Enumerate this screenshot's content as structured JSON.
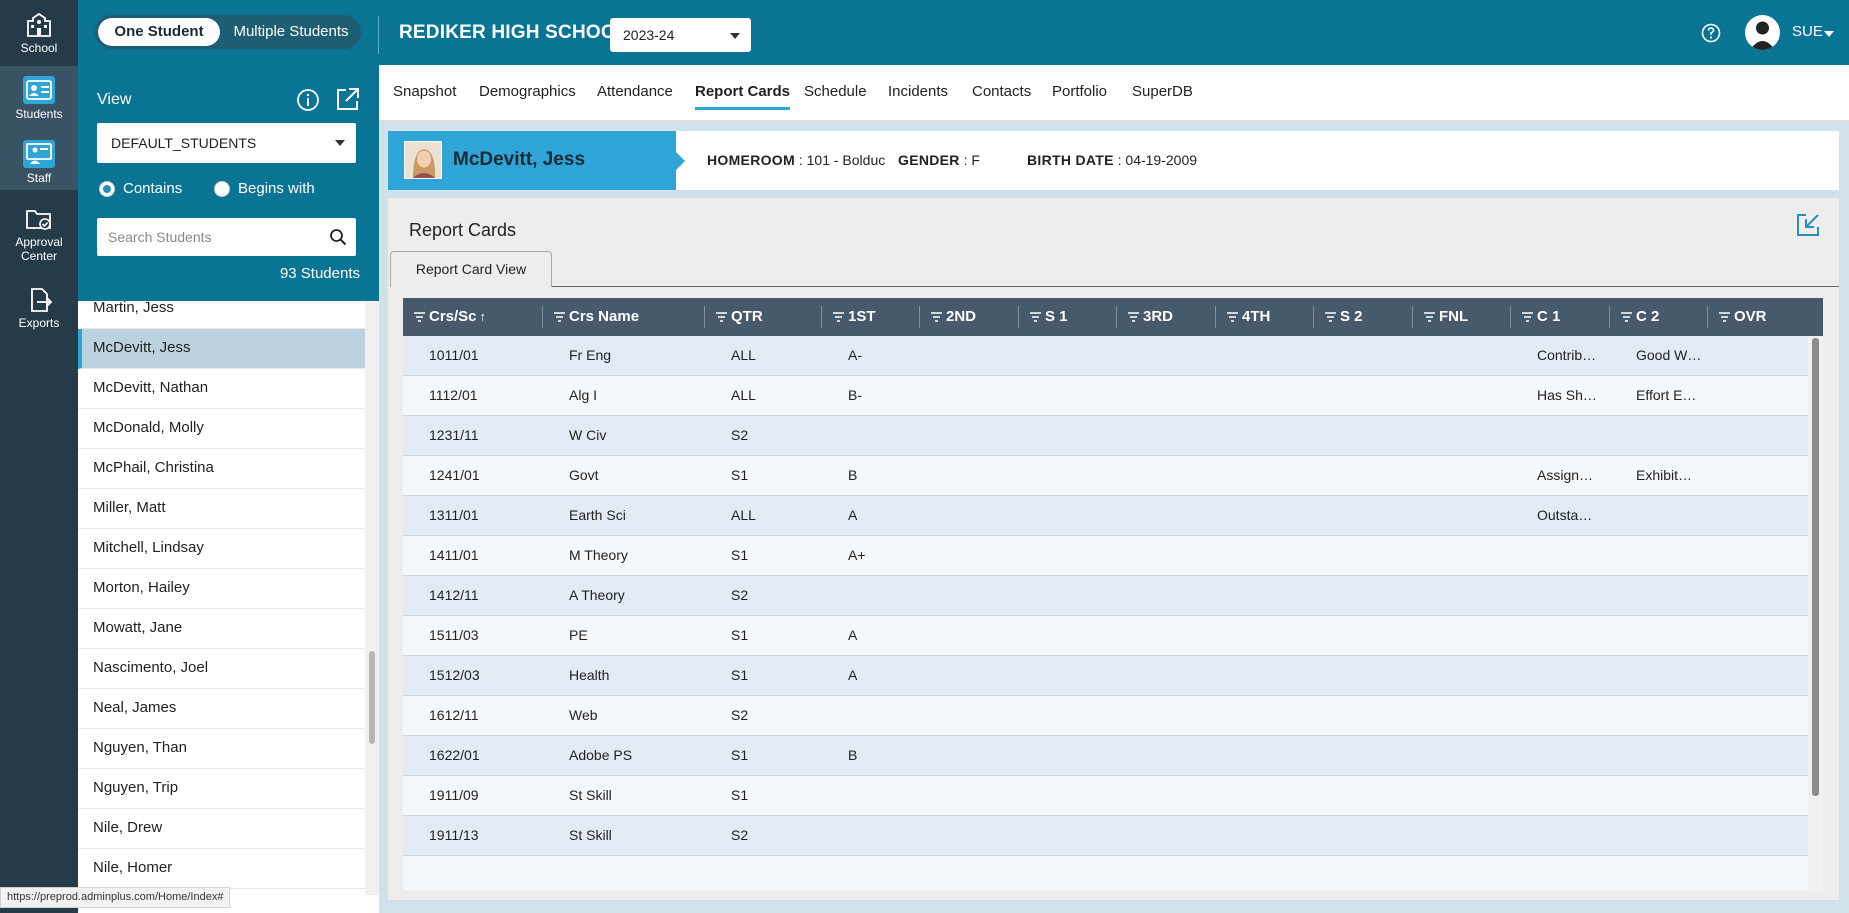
{
  "rail": {
    "items": [
      {
        "label": "School",
        "icon": "school-icon"
      },
      {
        "label": "Students",
        "icon": "students-icon"
      },
      {
        "label": "Staff",
        "icon": "staff-icon"
      },
      {
        "label": "Approval Center",
        "icon": "folder-check-icon"
      },
      {
        "label": "Exports",
        "icon": "export-file-icon"
      }
    ]
  },
  "topbar": {
    "toggle": {
      "one": "One Student",
      "multiple": "Multiple Students"
    },
    "school_name": "REDIKER HIGH SCHOOL",
    "year": "2023-24",
    "user": "SUE"
  },
  "panel": {
    "view_label": "View",
    "view_value": "DEFAULT_STUDENTS",
    "radio_contains": "Contains",
    "radio_begins": "Begins with",
    "search_placeholder": "Search Students",
    "count": "93 Students",
    "students": [
      "Martin, Jess",
      "McDevitt, Jess",
      "McDevitt, Nathan",
      "McDonald, Molly",
      "McPhail, Christina",
      "Miller, Matt",
      "Mitchell, Lindsay",
      "Morton, Hailey",
      "Mowatt, Jane",
      "Nascimento, Joel",
      "Neal, James",
      "Nguyen, Than",
      "Nguyen, Trip",
      "Nile, Drew",
      "Nile, Homer"
    ],
    "selected_index": 1
  },
  "status_url": "https://preprod.adminplus.com/Home/Index#",
  "tabs": [
    "Snapshot",
    "Demographics",
    "Attendance",
    "Report Cards",
    "Schedule",
    "Incidents",
    "Contacts",
    "Portfolio",
    "SuperDB"
  ],
  "active_tab": "Report Cards",
  "student": {
    "name": "McDevitt, Jess",
    "homeroom_label": "HOMEROOM",
    "homeroom_value": ": 101 - Bolduc",
    "gender_label": "GENDER",
    "gender_value": ": F",
    "birth_label": "BIRTH DATE",
    "birth_value": ": 04-19-2009"
  },
  "card": {
    "title": "Report Cards",
    "subtab": "Report Card View"
  },
  "grid": {
    "columns": [
      "Crs/Sc",
      "Crs Name",
      "QTR",
      "1ST",
      "2ND",
      "S 1",
      "3RD",
      "4TH",
      "S 2",
      "FNL",
      "C 1",
      "C 2",
      "OVR"
    ],
    "sort_indicator": "↑",
    "rows": [
      [
        "1011/01",
        "Fr Eng",
        "ALL",
        "A-",
        "",
        "",
        "",
        "",
        "",
        "",
        "Contrib…",
        "Good W…",
        ""
      ],
      [
        "1112/01",
        "Alg I",
        "ALL",
        "B-",
        "",
        "",
        "",
        "",
        "",
        "",
        "Has Sh…",
        "Effort E…",
        ""
      ],
      [
        "1231/11",
        "W Civ",
        "S2",
        "",
        "",
        "",
        "",
        "",
        "",
        "",
        "",
        "",
        ""
      ],
      [
        "1241/01",
        "Govt",
        "S1",
        "B",
        "",
        "",
        "",
        "",
        "",
        "",
        "Assign…",
        "Exhibit…",
        ""
      ],
      [
        "1311/01",
        "Earth Sci",
        "ALL",
        "A",
        "",
        "",
        "",
        "",
        "",
        "",
        "Outsta…",
        "",
        ""
      ],
      [
        "1411/01",
        "M Theory",
        "S1",
        "A+",
        "",
        "",
        "",
        "",
        "",
        "",
        "",
        "",
        ""
      ],
      [
        "1412/11",
        "A Theory",
        "S2",
        "",
        "",
        "",
        "",
        "",
        "",
        "",
        "",
        "",
        ""
      ],
      [
        "1511/03",
        "PE",
        "S1",
        "A",
        "",
        "",
        "",
        "",
        "",
        "",
        "",
        "",
        ""
      ],
      [
        "1512/03",
        "Health",
        "S1",
        "A",
        "",
        "",
        "",
        "",
        "",
        "",
        "",
        "",
        ""
      ],
      [
        "1612/11",
        "Web",
        "S2",
        "",
        "",
        "",
        "",
        "",
        "",
        "",
        "",
        "",
        ""
      ],
      [
        "1622/01",
        "Adobe PS",
        "S1",
        "B",
        "",
        "",
        "",
        "",
        "",
        "",
        "",
        "",
        ""
      ],
      [
        "1911/09",
        "St Skill",
        "S1",
        "",
        "",
        "",
        "",
        "",
        "",
        "",
        "",
        "",
        ""
      ],
      [
        "1911/13",
        "St Skill",
        "S2",
        "",
        "",
        "",
        "",
        "",
        "",
        "",
        "",
        "",
        ""
      ]
    ]
  },
  "colors": {
    "topbar": "#0a7495",
    "rail": "#253b48",
    "accent": "#2fa4d6",
    "grid_header": "#475a6b"
  }
}
